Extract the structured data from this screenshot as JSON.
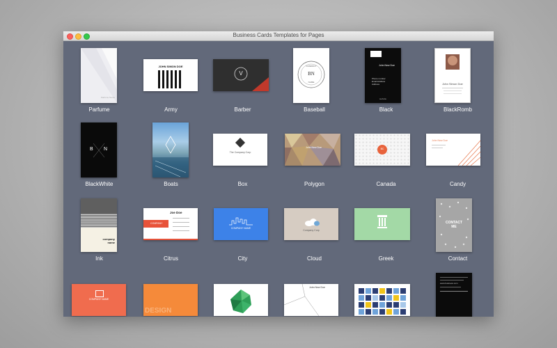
{
  "window": {
    "title": "Business Cards Templates for Pages"
  },
  "templates": [
    {
      "name": "Parfume",
      "card_text": "Parfume Name"
    },
    {
      "name": "Army",
      "card_text": "JOHN SIMON DOE"
    },
    {
      "name": "Barber",
      "card_text": "V"
    },
    {
      "name": "Baseball",
      "card_text": "BN",
      "card_text_top": "COMPANY",
      "card_text_bottom": "NAME"
    },
    {
      "name": "Black",
      "card_text": "John New Doe",
      "card_lines": [
        "Phone number",
        "Email Address",
        "Address"
      ],
      "card_footer": "website"
    },
    {
      "name": "BlackRomb",
      "card_text": "John Simon Doe"
    },
    {
      "name": "BlackWhite",
      "card_text": "B",
      "card_text_right": "N"
    },
    {
      "name": "Boats"
    },
    {
      "name": "Box",
      "card_text": "The Company Corp"
    },
    {
      "name": "Polygon",
      "card_text": "John New Doe"
    },
    {
      "name": "Canada",
      "card_text": "BC"
    },
    {
      "name": "Candy",
      "card_text": "John New Doe"
    },
    {
      "name": "Ink",
      "card_text": "company",
      "card_text2": "name"
    },
    {
      "name": "Citrus",
      "card_text": "Joe Doe",
      "card_brand": "COMPANY"
    },
    {
      "name": "City",
      "card_text": "COMPANY NAME"
    },
    {
      "name": "Cloud",
      "card_text": "Company Corp"
    },
    {
      "name": "Greek"
    },
    {
      "name": "Contact",
      "card_text": "CONTACT",
      "card_text2": "ME"
    },
    {
      "name": "",
      "card_text": "COMPANY NAME"
    },
    {
      "name": "",
      "card_text": "DESIGN"
    },
    {
      "name": ""
    },
    {
      "name": "",
      "card_text": "John New Doe"
    },
    {
      "name": ""
    },
    {
      "name": "",
      "card_text": "www.business.com"
    }
  ]
}
